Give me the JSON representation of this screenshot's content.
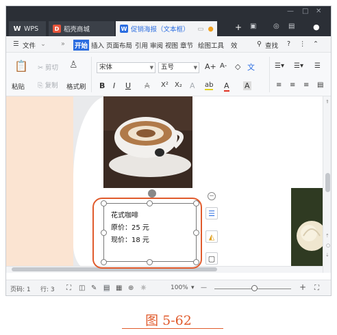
{
  "titlebar": {
    "tabs": [
      {
        "label": "WPS",
        "icon": "wps-logo-icon"
      },
      {
        "label": "稻壳商城",
        "icon": "docer-icon"
      },
      {
        "label": "促销海报（文本框）",
        "icon": "doc-icon"
      }
    ],
    "new_tab": "+"
  },
  "menubar": {
    "file": "文件",
    "tabs": [
      "开始",
      "插入",
      "页面布局",
      "引用",
      "审阅",
      "视图",
      "章节",
      "绘图工具",
      "效"
    ],
    "active": "开始",
    "search": "查找"
  },
  "ribbon": {
    "paste": "粘贴",
    "cut": "剪切",
    "copy": "复制",
    "format_painter": "格式刷",
    "font_name": "宋体",
    "font_size": "五号",
    "bold": "B",
    "italic": "I",
    "underline": "U",
    "font_color": "A",
    "superscript": "X²",
    "subscript": "X₂",
    "pinyin": "文",
    "highlight": "ab",
    "char_shade": "A",
    "grow": "A+",
    "shrink": "A-"
  },
  "document": {
    "textbox_lines": [
      "花式咖啡",
      "原价：25 元",
      "现价：18 元"
    ]
  },
  "statusbar": {
    "page": "页码: 1",
    "line": "行: 3",
    "zoom": "100%",
    "zoom_minus": "—",
    "zoom_plus": "+"
  },
  "caption": "图 5-62",
  "colors": {
    "accent": "#2b6de0",
    "highlight_outline": "#e05a2b",
    "titlebar": "#2b2f36",
    "page_bg": "#fbe4d2"
  }
}
